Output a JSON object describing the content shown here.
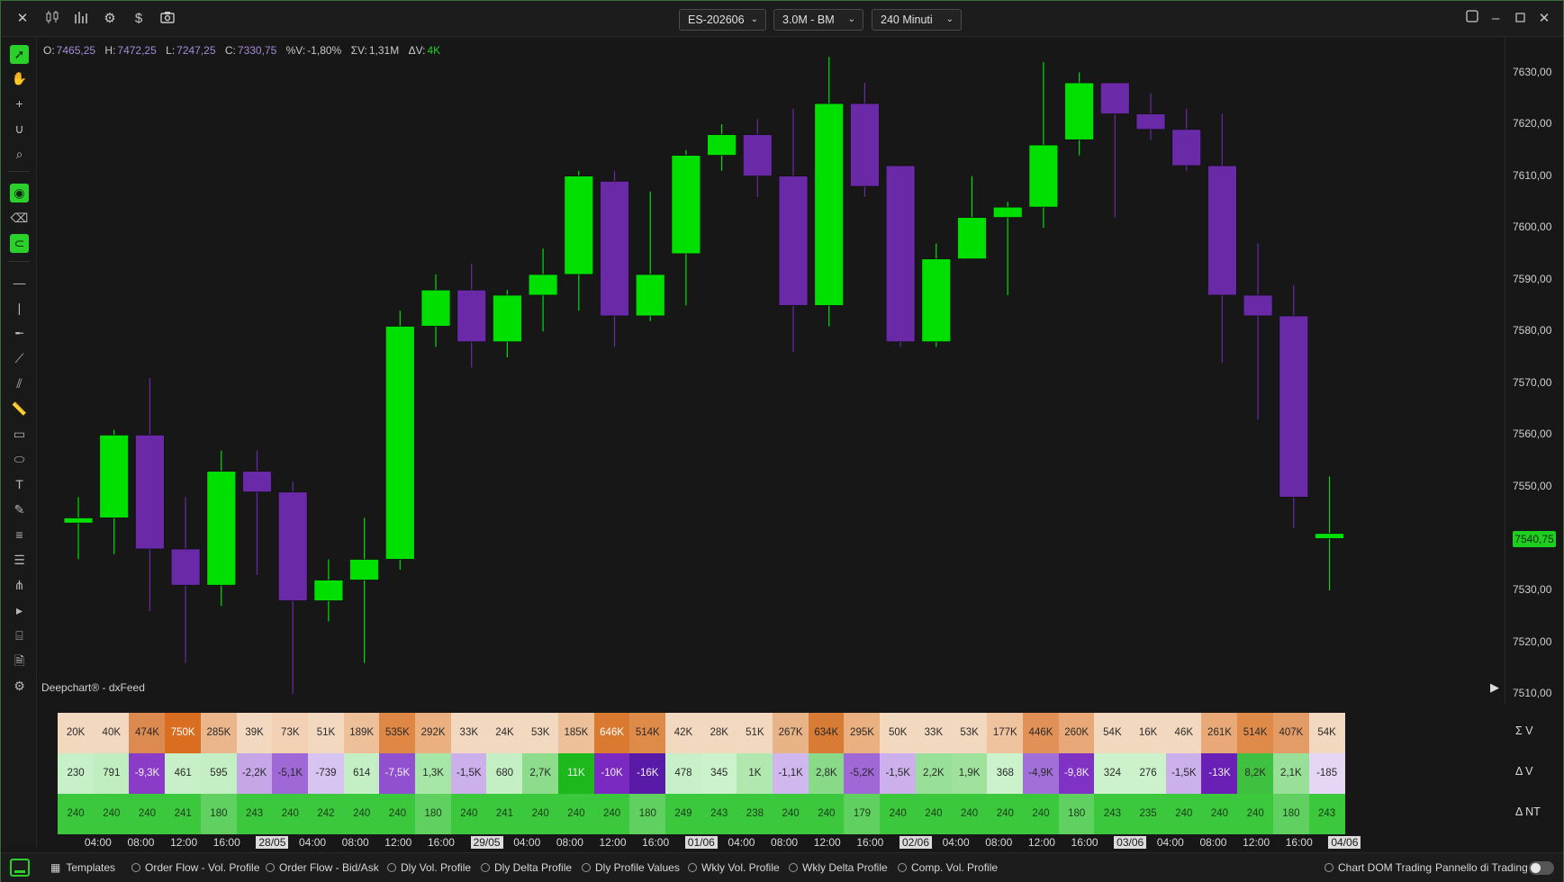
{
  "titlebar": {
    "icons": [
      "close-icon",
      "candlestick-icon",
      "bar-chart-icon",
      "settings-icon",
      "dollar-icon",
      "camera-icon"
    ],
    "symbol": "ES-202606",
    "bars": "3.0M - BM",
    "period": "240 Minuti",
    "window_icons": [
      "layout-icon",
      "minimize-icon",
      "maximize-icon",
      "close-window-icon"
    ]
  },
  "ohlc": {
    "o_label": "O:",
    "o": "7465,25",
    "h_label": "H:",
    "h": "7472,25",
    "l_label": "L:",
    "l": "7247,25",
    "c_label": "C:",
    "c": "7330,75",
    "pv_label": "%V:",
    "pv": "-1,80%",
    "sv_label": "ΣV:",
    "sv": "1,31M",
    "dv_label": "ΔV:",
    "dv": "4K"
  },
  "source": "Deepchart® - dxFeed",
  "price_axis": {
    "ticks": [
      "7630,00",
      "7620,00",
      "7610,00",
      "7600,00",
      "7590,00",
      "7580,00",
      "7570,00",
      "7560,00",
      "7550,00",
      "7540,00",
      "7530,00",
      "7520,00",
      "7510,00"
    ],
    "last_price": "7540,75"
  },
  "chart_data": {
    "type": "candlestick",
    "colors": {
      "up": "#00e000",
      "down": "#6a2aa8"
    },
    "ylim": [
      7510,
      7635
    ],
    "candles": [
      {
        "o": 7543,
        "h": 7548,
        "l": 7536,
        "c": 7544
      },
      {
        "o": 7544,
        "h": 7561,
        "l": 7537,
        "c": 7560
      },
      {
        "o": 7560,
        "h": 7571,
        "l": 7526,
        "c": 7538
      },
      {
        "o": 7538,
        "h": 7548,
        "l": 7516,
        "c": 7531
      },
      {
        "o": 7531,
        "h": 7557,
        "l": 7527,
        "c": 7553
      },
      {
        "o": 7553,
        "h": 7557,
        "l": 7533,
        "c": 7549
      },
      {
        "o": 7549,
        "h": 7551,
        "l": 7510,
        "c": 7528
      },
      {
        "o": 7528,
        "h": 7536,
        "l": 7524,
        "c": 7532
      },
      {
        "o": 7532,
        "h": 7544,
        "l": 7516,
        "c": 7536
      },
      {
        "o": 7536,
        "h": 7584,
        "l": 7534,
        "c": 7581
      },
      {
        "o": 7581,
        "h": 7591,
        "l": 7577,
        "c": 7588
      },
      {
        "o": 7588,
        "h": 7593,
        "l": 7573,
        "c": 7578
      },
      {
        "o": 7578,
        "h": 7588,
        "l": 7575,
        "c": 7587
      },
      {
        "o": 7587,
        "h": 7596,
        "l": 7580,
        "c": 7591
      },
      {
        "o": 7591,
        "h": 7611,
        "l": 7584,
        "c": 7610
      },
      {
        "o": 7609,
        "h": 7611,
        "l": 7577,
        "c": 7583
      },
      {
        "o": 7583,
        "h": 7607,
        "l": 7582,
        "c": 7591
      },
      {
        "o": 7595,
        "h": 7615,
        "l": 7585,
        "c": 7614
      },
      {
        "o": 7614,
        "h": 7620,
        "l": 7611,
        "c": 7618
      },
      {
        "o": 7618,
        "h": 7621,
        "l": 7606,
        "c": 7610
      },
      {
        "o": 7610,
        "h": 7623,
        "l": 7576,
        "c": 7585
      },
      {
        "o": 7585,
        "h": 7633,
        "l": 7581,
        "c": 7624
      },
      {
        "o": 7624,
        "h": 7628,
        "l": 7606,
        "c": 7608
      },
      {
        "o": 7612,
        "h": 7612,
        "l": 7577,
        "c": 7578
      },
      {
        "o": 7578,
        "h": 7597,
        "l": 7577,
        "c": 7594
      },
      {
        "o": 7594,
        "h": 7610,
        "l": 7594,
        "c": 7602
      },
      {
        "o": 7602,
        "h": 7605,
        "l": 7587,
        "c": 7604
      },
      {
        "o": 7604,
        "h": 7632,
        "l": 7600,
        "c": 7616
      },
      {
        "o": 7617,
        "h": 7630,
        "l": 7614,
        "c": 7628
      },
      {
        "o": 7628,
        "h": 7628,
        "l": 7602,
        "c": 7622
      },
      {
        "o": 7622,
        "h": 7626,
        "l": 7617,
        "c": 7619
      },
      {
        "o": 7619,
        "h": 7623,
        "l": 7611,
        "c": 7612
      },
      {
        "o": 7612,
        "h": 7622,
        "l": 7574,
        "c": 7587
      },
      {
        "o": 7587,
        "h": 7597,
        "l": 7563,
        "c": 7583
      },
      {
        "o": 7583,
        "h": 7589,
        "l": 7542,
        "c": 7548
      },
      {
        "o": 7540,
        "h": 7552,
        "l": 7530,
        "c": 7541
      }
    ]
  },
  "stats": {
    "labels": [
      "Σ V",
      "Δ V",
      "Δ NT"
    ],
    "sum_v": {
      "values": [
        "20K",
        "40K",
        "474K",
        "750K",
        "285K",
        "39K",
        "73K",
        "51K",
        "189K",
        "535K",
        "292K",
        "33K",
        "24K",
        "53K",
        "185K",
        "646K",
        "514K",
        "42K",
        "28K",
        "51K",
        "267K",
        "634K",
        "295K",
        "50K",
        "33K",
        "53K",
        "177K",
        "446K",
        "260K",
        "54K",
        "16K",
        "46K",
        "261K",
        "514K",
        "407K",
        "54K"
      ],
      "colors": [
        "#f3d8c0",
        "#f3d8c0",
        "#dc8a50",
        "#d96e20",
        "#ebb68c",
        "#f3d8c0",
        "#f1d0b4",
        "#f3d8c0",
        "#eec09a",
        "#df8845",
        "#eab080",
        "#f3d8c0",
        "#f3d8c0",
        "#f3d8c0",
        "#eec09a",
        "#d97a30",
        "#de8a48",
        "#f3d8c0",
        "#f3d8c0",
        "#f3d8c0",
        "#e9b388",
        "#d87b34",
        "#eab080",
        "#f3d8c0",
        "#f3d8c0",
        "#f3d8c0",
        "#efc39e",
        "#e19158",
        "#e8a878",
        "#f3d8c0",
        "#f3d8c0",
        "#f3d8c0",
        "#e8a878",
        "#df8a48",
        "#e39c66",
        "#f3d8c0"
      ]
    },
    "delta_v": {
      "values": [
        "230",
        "791",
        "-9,3K",
        "461",
        "595",
        "-2,2K",
        "-5,1K",
        "-739",
        "614",
        "-7,5K",
        "1,3K",
        "-1,5K",
        "680",
        "2,7K",
        "11K",
        "-10K",
        "-16K",
        "478",
        "345",
        "1K",
        "-1,1K",
        "2,8K",
        "-5,2K",
        "-1,5K",
        "2,2K",
        "1,9K",
        "368",
        "-4,9K",
        "-9,8K",
        "324",
        "276",
        "-1,5K",
        "-13K",
        "8,2K",
        "2,1K",
        "-185"
      ],
      "colors": [
        "#c8f0c8",
        "#c0eec0",
        "#8a3cc8",
        "#c8f0c8",
        "#c4eec4",
        "#c7a6e8",
        "#a068d6",
        "#d8c4f0",
        "#c4eec4",
        "#9050d0",
        "#a6e6a6",
        "#ccb0ec",
        "#c4eec4",
        "#8cdc8c",
        "#1cb81c",
        "#7a2ac0",
        "#5a1aa8",
        "#c8f0c8",
        "#cbf2cb",
        "#b0e8b0",
        "#d0b8ee",
        "#88da88",
        "#a068d6",
        "#ccb0ec",
        "#98e098",
        "#9ee29e",
        "#cbf2cb",
        "#a070d8",
        "#8032c4",
        "#cbf2cb",
        "#cbf2cb",
        "#ccb0ec",
        "#6a20b4",
        "#40c040",
        "#98e098",
        "#e4d6f4"
      ],
      "light_indices": [
        2,
        9,
        14,
        15,
        16,
        28,
        32
      ]
    },
    "delta_nt": {
      "values": [
        "240",
        "240",
        "240",
        "241",
        "180",
        "243",
        "240",
        "242",
        "240",
        "240",
        "180",
        "240",
        "241",
        "240",
        "240",
        "240",
        "180",
        "249",
        "243",
        "238",
        "240",
        "240",
        "179",
        "240",
        "240",
        "240",
        "240",
        "240",
        "180",
        "243",
        "235",
        "240",
        "240",
        "240",
        "180",
        "243"
      ],
      "colors": [
        "#3cc83c",
        "#3cc83c",
        "#3cc83c",
        "#3cc83c",
        "#60d060",
        "#3cc83c",
        "#3cc83c",
        "#3cc83c",
        "#3cc83c",
        "#3cc83c",
        "#60d060",
        "#3cc83c",
        "#3cc83c",
        "#3cc83c",
        "#3cc83c",
        "#3cc83c",
        "#60d060",
        "#3cc83c",
        "#3cc83c",
        "#3cc83c",
        "#3cc83c",
        "#3cc83c",
        "#60d060",
        "#3cc83c",
        "#3cc83c",
        "#3cc83c",
        "#3cc83c",
        "#3cc83c",
        "#60d060",
        "#3cc83c",
        "#3cc83c",
        "#3cc83c",
        "#3cc83c",
        "#3cc83c",
        "#60d060",
        "#3cc83c"
      ]
    }
  },
  "time_axis": [
    {
      "t": "04:00",
      "date": false
    },
    {
      "t": "08:00",
      "date": false
    },
    {
      "t": "12:00",
      "date": false
    },
    {
      "t": "16:00",
      "date": false
    },
    {
      "t": "28/05",
      "date": true
    },
    {
      "t": "04:00",
      "date": false
    },
    {
      "t": "08:00",
      "date": false
    },
    {
      "t": "12:00",
      "date": false
    },
    {
      "t": "16:00",
      "date": false
    },
    {
      "t": "29/05",
      "date": true
    },
    {
      "t": "04:00",
      "date": false
    },
    {
      "t": "08:00",
      "date": false
    },
    {
      "t": "12:00",
      "date": false
    },
    {
      "t": "16:00",
      "date": false
    },
    {
      "t": "01/06",
      "date": true
    },
    {
      "t": "04:00",
      "date": false
    },
    {
      "t": "08:00",
      "date": false
    },
    {
      "t": "12:00",
      "date": false
    },
    {
      "t": "16:00",
      "date": false
    },
    {
      "t": "02/06",
      "date": true
    },
    {
      "t": "04:00",
      "date": false
    },
    {
      "t": "08:00",
      "date": false
    },
    {
      "t": "12:00",
      "date": false
    },
    {
      "t": "16:00",
      "date": false
    },
    {
      "t": "03/06",
      "date": true
    },
    {
      "t": "04:00",
      "date": false
    },
    {
      "t": "08:00",
      "date": false
    },
    {
      "t": "12:00",
      "date": false
    },
    {
      "t": "16:00",
      "date": false
    },
    {
      "t": "04/06",
      "date": true
    }
  ],
  "footer": {
    "templates": "Templates",
    "options": [
      "Order Flow - Vol. Profile",
      "Order Flow - Bid/Ask",
      "Dly Vol. Profile",
      "Dly Delta Profile",
      "Dly Profile Values",
      "Wkly Vol. Profile",
      "Wkly Delta Profile",
      "Comp. Vol. Profile"
    ],
    "chart_dom": "Chart DOM Trading",
    "trading_panel": "Pannello di Trading"
  }
}
